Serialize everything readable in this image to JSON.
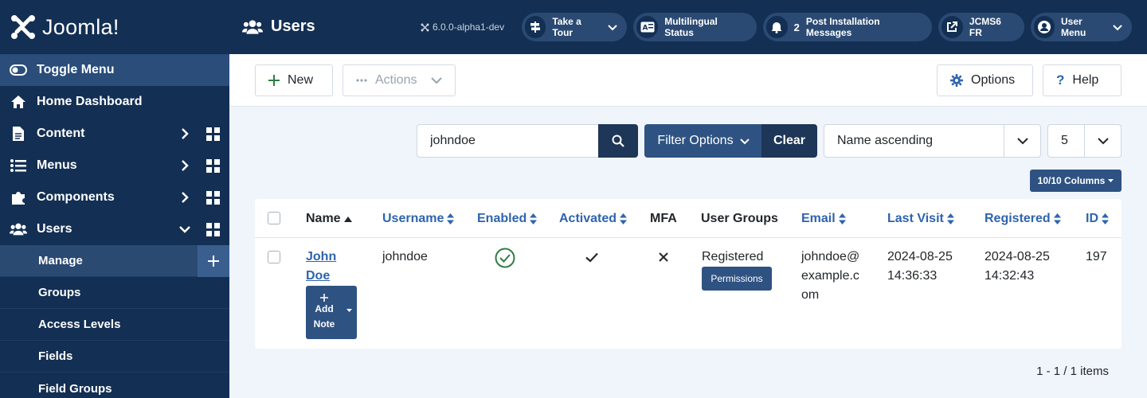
{
  "brand": {
    "name": "Joomla!"
  },
  "sidebar": {
    "toggle_label": "Toggle Menu",
    "items": [
      {
        "label": "Home Dashboard",
        "icon": "home-icon"
      },
      {
        "label": "Content",
        "icon": "file-icon"
      },
      {
        "label": "Menus",
        "icon": "list-icon"
      },
      {
        "label": "Components",
        "icon": "puzzle-icon"
      },
      {
        "label": "Users",
        "icon": "users-icon"
      }
    ],
    "subitems": [
      {
        "label": "Manage"
      },
      {
        "label": "Groups"
      },
      {
        "label": "Access Levels"
      },
      {
        "label": "Fields"
      },
      {
        "label": "Field Groups"
      }
    ]
  },
  "header": {
    "title": "Users",
    "version": "6.0.0-alpha1-dev",
    "tour": "Take a Tour",
    "multilingual": "Multilingual Status",
    "post_count": "2",
    "post_label": "Post Installation Messages",
    "site": "JCMS6 FR",
    "user_menu": "User Menu"
  },
  "toolbar": {
    "new_label": "New",
    "actions_label": "Actions",
    "options_label": "Options",
    "help_label": "Help"
  },
  "filters": {
    "search_value": "johndoe",
    "filter_options_label": "Filter Options",
    "clear_label": "Clear",
    "sort_value": "Name ascending",
    "limit_value": "5",
    "columns_label": "10/10 Columns"
  },
  "table": {
    "headers": [
      "Name",
      "Username",
      "Enabled",
      "Activated",
      "MFA",
      "User Groups",
      "Email",
      "Last Visit",
      "Registered",
      "ID"
    ],
    "row": {
      "name_line1": "John",
      "name_line2": "Doe",
      "add_note": "Add",
      "add_note2": "Note",
      "username": "johndoe",
      "group": "Registered",
      "permissions": "Permissions",
      "email1": "johndoe@",
      "email2": "example.c",
      "email3": "om",
      "last_visit_date": "2024-08-25",
      "last_visit_time": "14:36:33",
      "registered_date": "2024-08-25",
      "registered_time": "14:32:43",
      "id": "197"
    }
  },
  "pagination": {
    "text": "1 - 1 / 1 items"
  },
  "colors": {
    "sidebar": "#132f53",
    "accent": "#2e5282",
    "link": "#2e64ad",
    "success": "#2f7d46"
  }
}
